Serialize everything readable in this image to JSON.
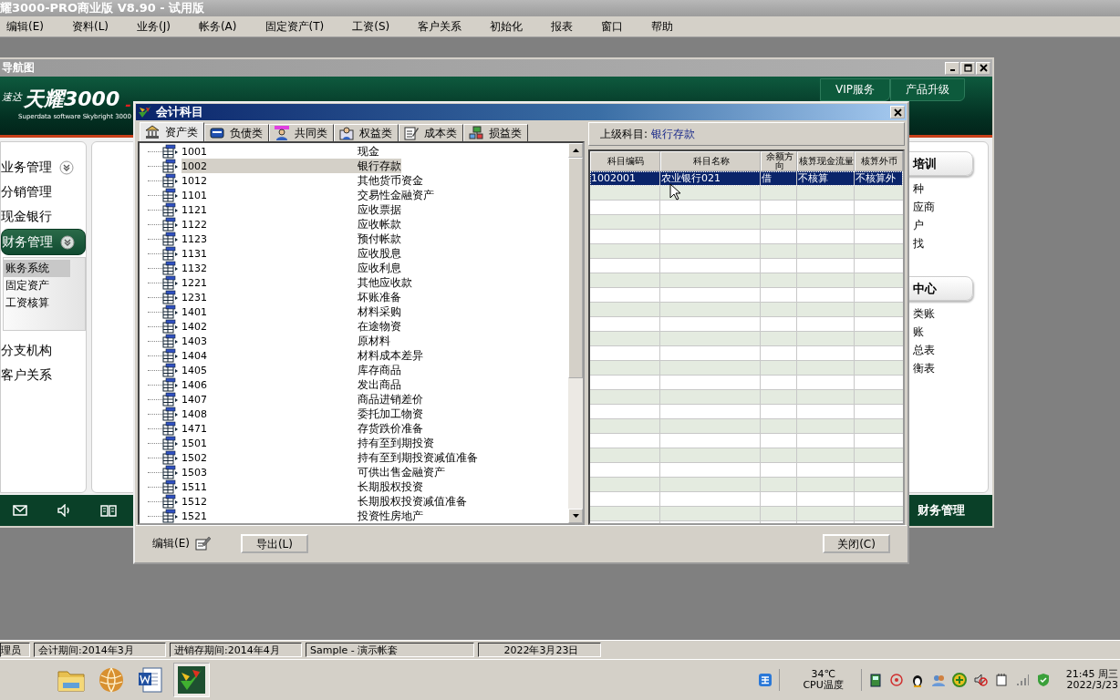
{
  "app": {
    "title": "耀3000-PRO商业版 V8.90 - 试用版"
  },
  "menu": [
    "编辑(E)",
    "资料(L)",
    "业务(J)",
    "帐务(A)",
    "固定资产(T)",
    "工资(S)",
    "客户关系",
    "初始化",
    "报表",
    "窗口",
    "帮助"
  ],
  "nav_window": {
    "title": "导航图",
    "logo": {
      "brand_small": "速达",
      "brand": "天耀3000",
      "suffix": "-",
      "tagline": "Superdata software Skybright 3000"
    },
    "header_tabs": [
      "VIP服务",
      "产品升级"
    ],
    "sidebar": [
      {
        "label": "业务管理",
        "kind": "group",
        "expanded": false
      },
      {
        "label": "分销管理",
        "kind": "link"
      },
      {
        "label": "现金银行",
        "kind": "link"
      },
      {
        "label": "财务管理",
        "kind": "group",
        "expanded": true,
        "children": [
          {
            "label": "账务系统",
            "selected": true
          },
          {
            "label": "固定资产",
            "selected": false
          },
          {
            "label": "工资核算",
            "selected": false
          }
        ]
      },
      {
        "label": "分支机构",
        "kind": "link"
      },
      {
        "label": "客户关系",
        "kind": "link"
      }
    ],
    "right_sections": [
      {
        "title": "培训",
        "items": [
          "种",
          "应商",
          "户",
          "找"
        ]
      },
      {
        "title": "中心",
        "items": [
          "类账",
          "账",
          "总表",
          "衡表"
        ]
      }
    ],
    "footer_label": "财务管理"
  },
  "dialog": {
    "title": "会计科目",
    "tabs": [
      {
        "label": "资产类",
        "kind": "bank",
        "selected": true
      },
      {
        "label": "负债类",
        "kind": "card",
        "selected": false
      },
      {
        "label": "共同类",
        "kind": "people",
        "selected": false
      },
      {
        "label": "权益类",
        "kind": "person",
        "selected": false
      },
      {
        "label": "成本类",
        "kind": "notepad",
        "selected": false
      },
      {
        "label": "损益类",
        "kind": "network",
        "selected": false
      }
    ],
    "accounts": [
      {
        "code": "1001",
        "name": "现金",
        "selected": false
      },
      {
        "code": "1002",
        "name": "银行存款",
        "selected": true
      },
      {
        "code": "1012",
        "name": "其他货币资金",
        "selected": false
      },
      {
        "code": "1101",
        "name": "交易性金融资产",
        "selected": false
      },
      {
        "code": "1121",
        "name": "应收票据",
        "selected": false
      },
      {
        "code": "1122",
        "name": "应收帐款",
        "selected": false
      },
      {
        "code": "1123",
        "name": "预付帐款",
        "selected": false
      },
      {
        "code": "1131",
        "name": "应收股息",
        "selected": false
      },
      {
        "code": "1132",
        "name": "应收利息",
        "selected": false
      },
      {
        "code": "1221",
        "name": "其他应收款",
        "selected": false
      },
      {
        "code": "1231",
        "name": "坏账准备",
        "selected": false
      },
      {
        "code": "1401",
        "name": "材料采购",
        "selected": false
      },
      {
        "code": "1402",
        "name": "在途物资",
        "selected": false
      },
      {
        "code": "1403",
        "name": "原材料",
        "selected": false
      },
      {
        "code": "1404",
        "name": "材料成本差异",
        "selected": false
      },
      {
        "code": "1405",
        "name": "库存商品",
        "selected": false
      },
      {
        "code": "1406",
        "name": "发出商品",
        "selected": false
      },
      {
        "code": "1407",
        "name": "商品进销差价",
        "selected": false
      },
      {
        "code": "1408",
        "name": "委托加工物资",
        "selected": false
      },
      {
        "code": "1471",
        "name": "存货跌价准备",
        "selected": false
      },
      {
        "code": "1501",
        "name": "持有至到期投资",
        "selected": false
      },
      {
        "code": "1502",
        "name": "持有至到期投资减值准备",
        "selected": false
      },
      {
        "code": "1503",
        "name": "可供出售金融资产",
        "selected": false
      },
      {
        "code": "1511",
        "name": "长期股权投资",
        "selected": false
      },
      {
        "code": "1512",
        "name": "长期股权投资减值准备",
        "selected": false
      },
      {
        "code": "1521",
        "name": "投资性房地产",
        "selected": false
      }
    ],
    "parent_label": "上级科目:",
    "parent_value": "银行存款",
    "grid": {
      "columns": [
        "科目编码",
        "科目名称",
        "余额方向",
        "核算现金流量",
        "核算外币"
      ],
      "rows": [
        {
          "cells": [
            "1002001",
            "农业银行021",
            "借",
            "不核算",
            "不核算外"
          ],
          "selected": true
        }
      ]
    },
    "footer": {
      "edit_label": "编辑(E)",
      "buttons": [
        "导出(L)",
        "关闭(C)"
      ]
    }
  },
  "status_bar": [
    "理员",
    "会计期间:2014年3月",
    "进销存期间:2014年4月",
    "Sample - 演示帐套",
    "2022年3月23日"
  ],
  "taskbar": {
    "apps": [
      {
        "kind": "folder",
        "selected": false
      },
      {
        "kind": "globe",
        "selected": false
      },
      {
        "kind": "document",
        "selected": false
      },
      {
        "kind": "logo",
        "selected": true
      }
    ]
  },
  "tray": {
    "temperature": "34℃",
    "temperature_label": "CPU温度",
    "time": "21:45 周三",
    "date": "2022/3/23"
  }
}
